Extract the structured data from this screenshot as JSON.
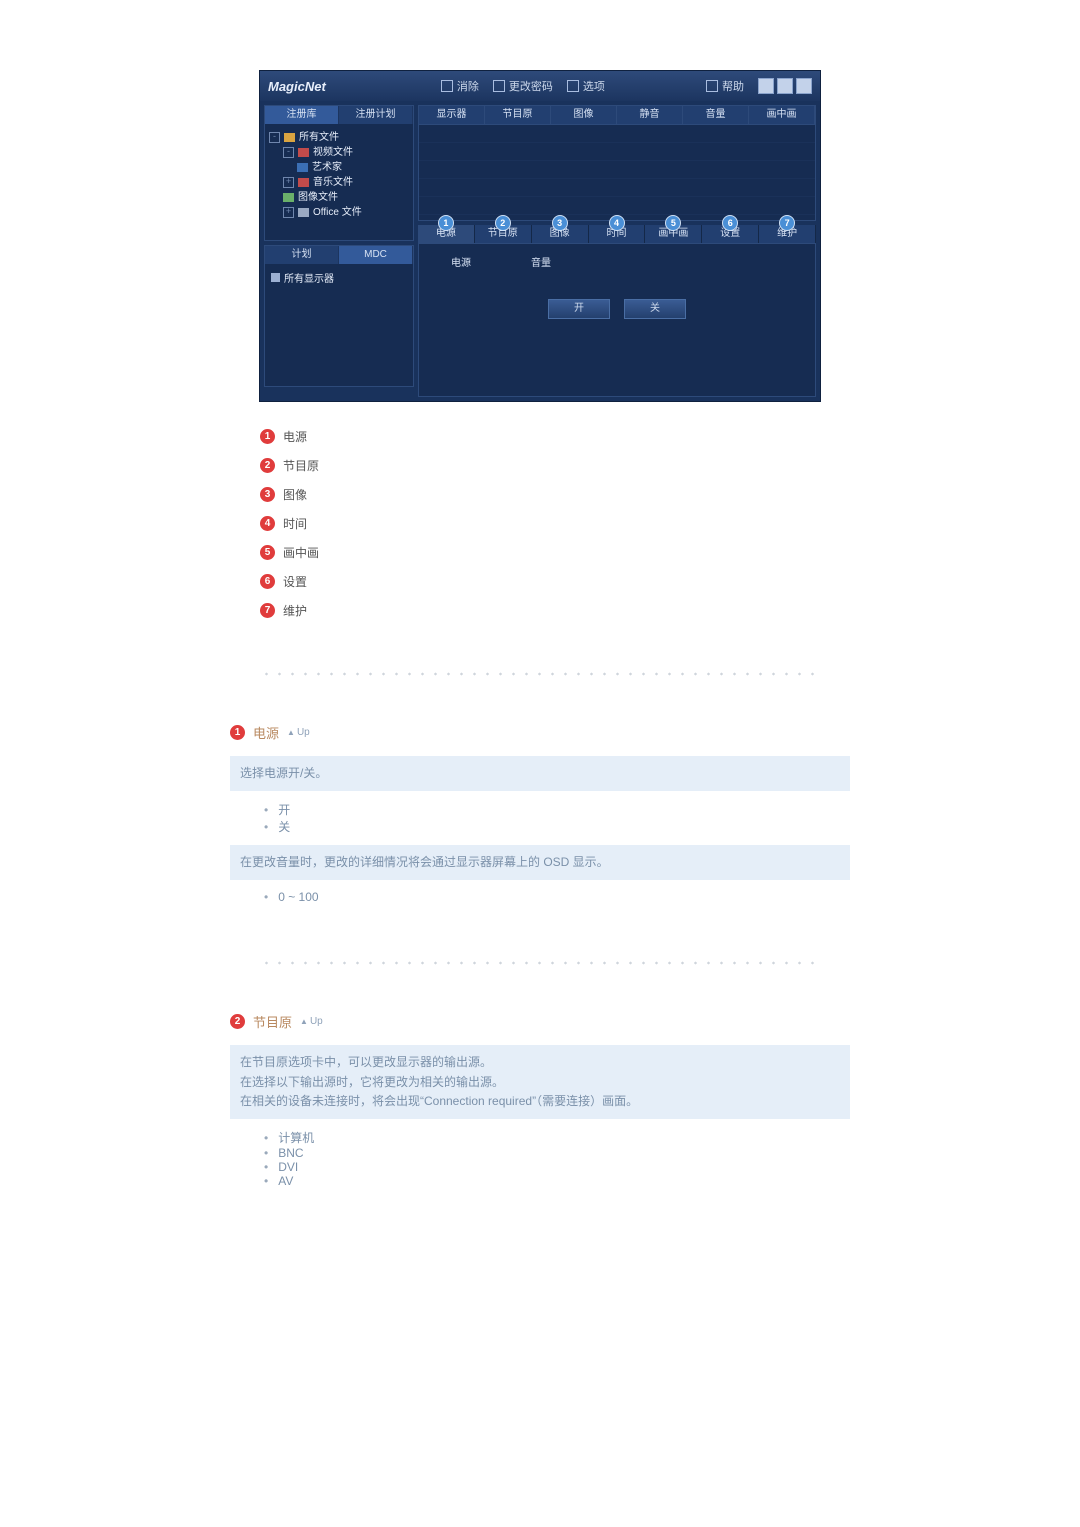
{
  "app": {
    "logo": "MagicNet",
    "titlebar": {
      "items": [
        "消除",
        "更改密码",
        "选项",
        "帮助"
      ]
    },
    "left": {
      "tabsTop": [
        "注册库",
        "注册计划"
      ],
      "tree": {
        "root": "所有文件",
        "items": [
          {
            "icon": "red",
            "label": "视频文件"
          },
          {
            "icon": "cam",
            "label": "艺术家",
            "indent": 2
          },
          {
            "icon": "red",
            "label": "音乐文件"
          },
          {
            "icon": "green",
            "label": "图像文件"
          },
          {
            "icon": "gray",
            "label": "Office 文件"
          }
        ]
      },
      "tabsBottom": [
        "计划",
        "MDC"
      ],
      "listItem": "所有显示器"
    },
    "right": {
      "columns": [
        "显示器",
        "节目原",
        "图像",
        "静音",
        "音量",
        "画中画"
      ],
      "tabs": [
        "电源",
        "节目原",
        "图像",
        "时间",
        "画中画",
        "设置",
        "维护"
      ],
      "detail": {
        "labels": [
          "电源",
          "音量"
        ],
        "buttons": [
          "开",
          "关"
        ]
      }
    }
  },
  "legend": {
    "items": [
      "电源",
      "节目原",
      "图像",
      "时间",
      "画中画",
      "设置",
      "维护"
    ]
  },
  "section1": {
    "num": "1",
    "title": "电源",
    "up": "Up",
    "box1": "选择电源开/关。",
    "list1": [
      "开",
      "关"
    ],
    "box2": "在更改音量时，更改的详细情况将会通过显示器屏幕上的 OSD 显示。",
    "list2": [
      "0 ~ 100"
    ]
  },
  "section2": {
    "num": "2",
    "title": "节目原",
    "up": "Up",
    "boxLines": [
      "在节目原选项卡中，可以更改显示器的输出源。",
      "在选择以下输出源时，它将更改为相关的输出源。",
      "在相关的设备未连接时，将会出现“Connection required”（需要连接）画面。"
    ],
    "list": [
      "计算机",
      "BNC",
      "DVI",
      "AV"
    ]
  }
}
